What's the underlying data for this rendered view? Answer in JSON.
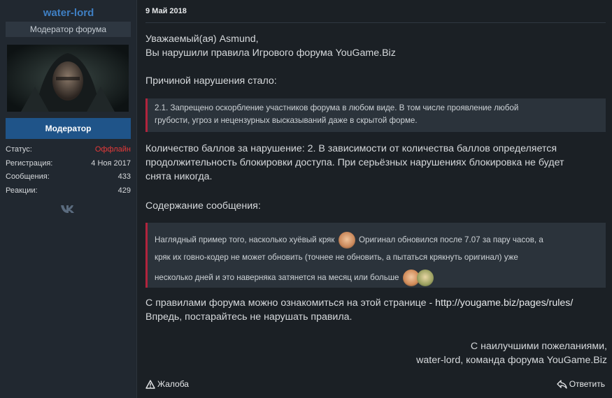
{
  "user": {
    "name": "water-lord",
    "title": "Модератор форума",
    "role": "Модератор",
    "stats": [
      {
        "label": "Статус:",
        "value": "Оффлайн"
      },
      {
        "label": "Регистрация:",
        "value": "4 Ноя 2017"
      },
      {
        "label": "Сообщения:",
        "value": "433"
      },
      {
        "label": "Реакции:",
        "value": "429"
      }
    ],
    "social_icon": "vk-icon"
  },
  "post": {
    "date": "9 Май 2018",
    "greeting": "Уважаемый(ая) Asmund,",
    "intro": "Вы нарушили правила Игрового форума YouGame.Biz",
    "reason_label": "Причиной нарушения стало:",
    "rule_quote_line1": "2.1. Запрещено оскорбление участников форума в любом виде. В том числе проявление любой",
    "rule_quote_line2": "грубости, угроз и нецензурных высказываний даже в скрытой форме.",
    "points_line1": "Количество баллов за нарушение: 2. В зависимости от количества баллов определяется",
    "points_line2": "продолжительность блокировки доступа. При серьёзных нарушениях блокировка не будет",
    "points_line3": "снята никогда.",
    "content_label": "Содержание сообщения:",
    "msg_line1_a": "Наглядный пример того, насколько хуёвый кряк",
    "msg_line1_b": "Оригинал обновился после 7.07 за пару часов, а",
    "msg_line2": "кряк их говно-кодер не может обновить (точнее не обновить, а пытаться крякнуть оригинал) уже",
    "msg_line3": "несколько дней и это наверняка затянется на месяц или больше",
    "rules_text": "С правилами форума можно ознакомиться на этой странице - ",
    "rules_link": "http://yougame.biz/pages/rules/",
    "closing_advice": "Впредь, постарайтесь не нарушать правила.",
    "signoff": "С наилучшими пожеланиями,",
    "signature": "water-lord, команда форума YouGame.Biz"
  },
  "actions": {
    "report_label": "Жалоба",
    "reply_label": "Ответить"
  },
  "colors": {
    "background": "#1b2025",
    "panel": "#212830",
    "accent_blue": "#1f5489",
    "username": "#3f7fc3",
    "offline": "#e63a3a",
    "quote_border": "#b1243d"
  }
}
